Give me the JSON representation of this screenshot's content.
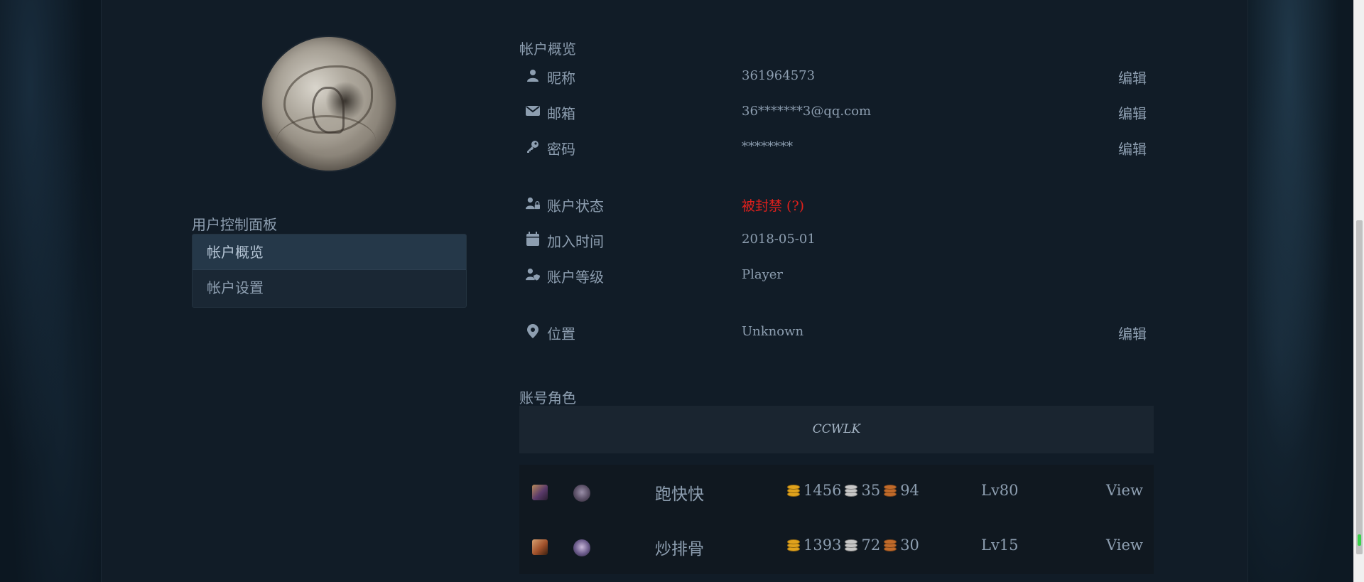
{
  "sidebar": {
    "panel_title": "用户控制面板",
    "items": [
      {
        "label": "帐户概览",
        "active": true
      },
      {
        "label": "帐户设置",
        "active": false
      }
    ]
  },
  "overview": {
    "title": "帐户概览",
    "nickname": {
      "label": "昵称",
      "value": "361964573",
      "edit": "编辑",
      "icon": "user-icon"
    },
    "email": {
      "label": "邮箱",
      "value": "36*******3@qq.com",
      "edit": "编辑",
      "icon": "envelope-icon"
    },
    "password": {
      "label": "密码",
      "value": "********",
      "edit": "编辑",
      "icon": "key-icon"
    },
    "status": {
      "label": "账户状态",
      "value": "被封禁 (?)",
      "icon": "user-lock-icon",
      "color": "#e0201c"
    },
    "joined": {
      "label": "加入时间",
      "value": "2018-05-01",
      "icon": "calendar-icon"
    },
    "level": {
      "label": "账户等级",
      "value": "Player",
      "icon": "user-shield-icon"
    },
    "location": {
      "label": "位置",
      "value": "Unknown",
      "edit": "编辑",
      "icon": "map-pin-icon"
    }
  },
  "characters": {
    "title": "账号角色",
    "realm": "CCWLK",
    "rows": [
      {
        "name": "跑快快",
        "gold": "1456",
        "silver": "35",
        "copper": "94",
        "level": "Lv80",
        "view": "View",
        "race_icon": "blood-elf-female-icon",
        "class_icon": "warlock-icon"
      },
      {
        "name": "炒排骨",
        "gold": "1393",
        "silver": "72",
        "copper": "30",
        "level": "Lv15",
        "view": "View",
        "race_icon": "human-female-icon",
        "class_icon": "rogue-icon"
      }
    ]
  },
  "colors": {
    "page_bg": "#111c27",
    "text": "#8d9eb0",
    "banned": "#e0201c",
    "gold": "#e0a21c",
    "silver": "#c7c7c7",
    "copper": "#c06a2a"
  }
}
